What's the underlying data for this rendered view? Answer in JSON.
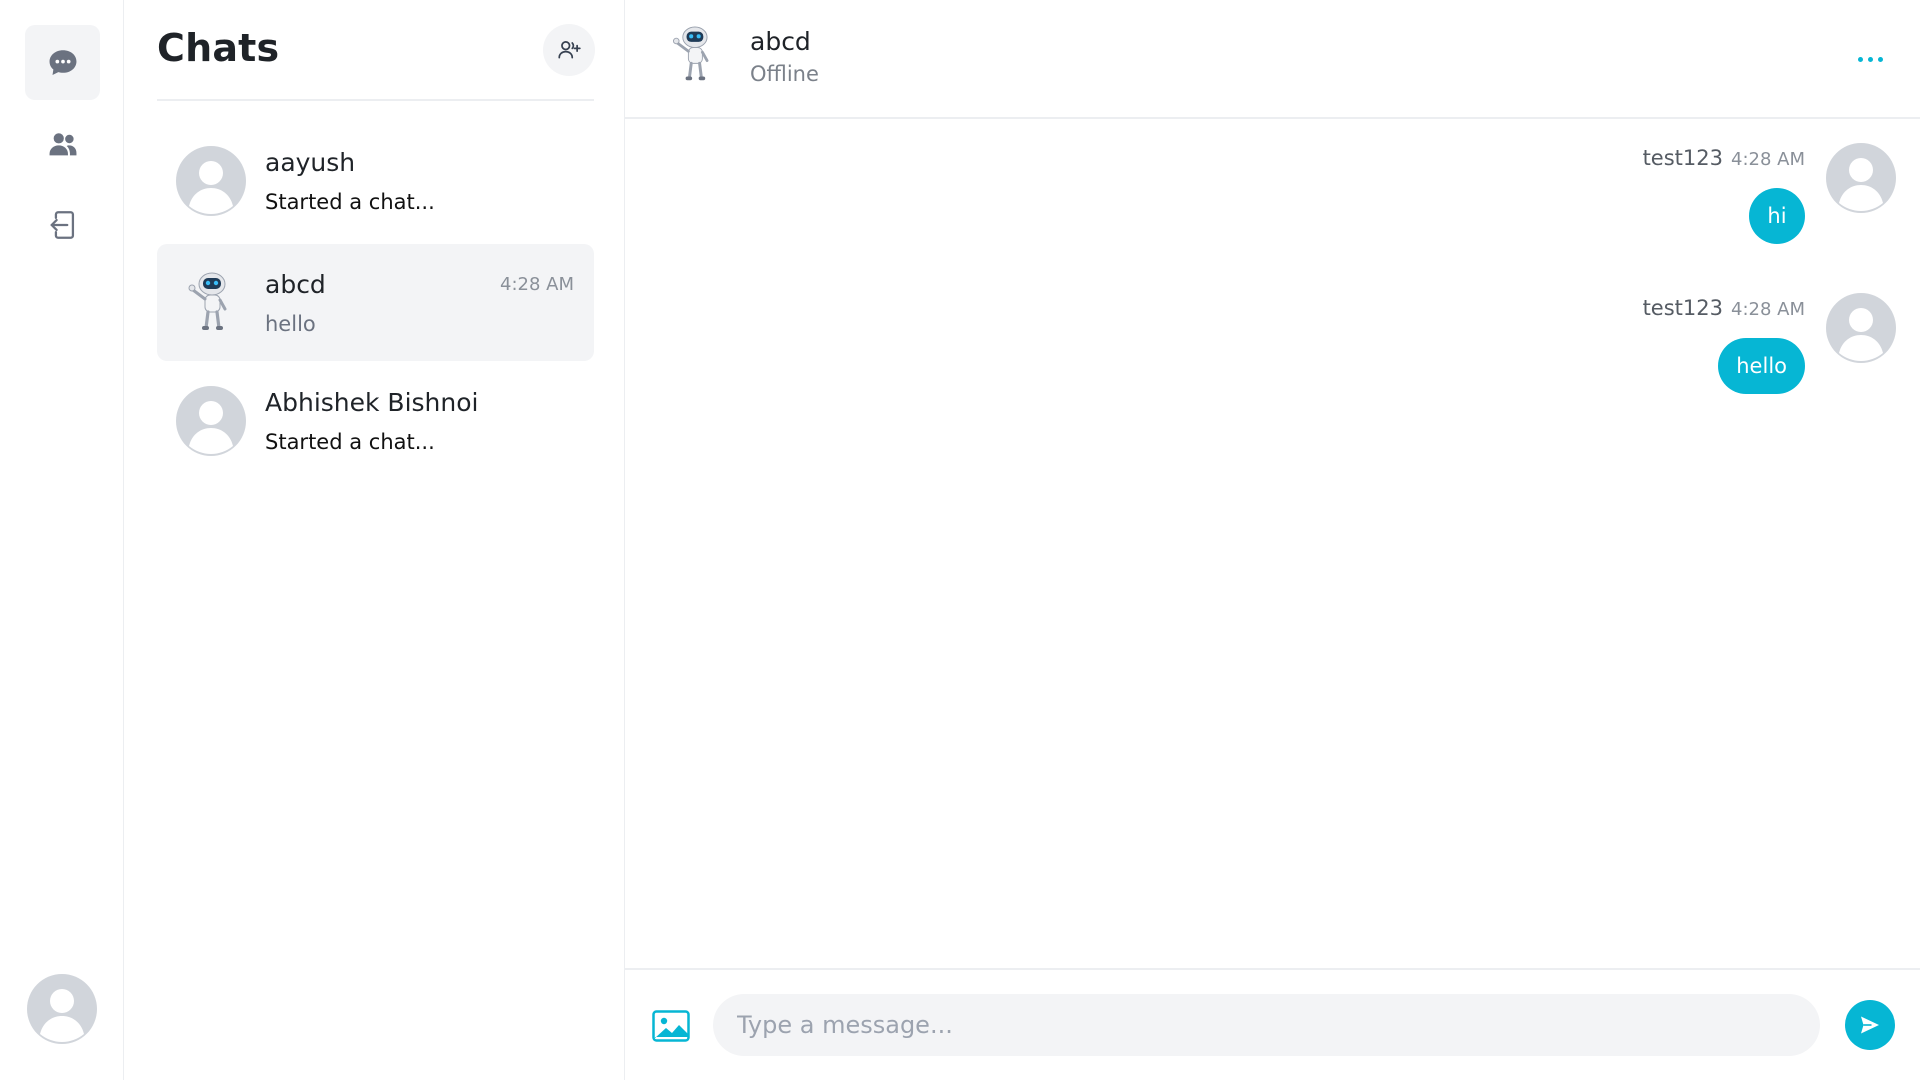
{
  "theme": {
    "accent": "#06b6d4",
    "icon_gray": "#6b7280",
    "avatar_gray": "#d1d5db"
  },
  "rail": {
    "items": [
      {
        "icon": "chat-bubble-icon",
        "active": true
      },
      {
        "icon": "users-icon",
        "active": false
      },
      {
        "icon": "logout-icon",
        "active": false
      }
    ],
    "profile_icon": "user-avatar-icon"
  },
  "chat_list": {
    "title": "Chats",
    "add_icon": "add-user-icon",
    "conversations": [
      {
        "name": "aayush",
        "preview": "Started a chat...",
        "time": "",
        "avatar": "default-avatar",
        "selected": false
      },
      {
        "name": "abcd",
        "preview": "hello",
        "time": "4:28 AM",
        "avatar": "robot-avatar",
        "selected": true
      },
      {
        "name": "Abhishek Bishnoi",
        "preview": "Started a chat...",
        "time": "",
        "avatar": "default-avatar",
        "selected": false
      }
    ]
  },
  "chat": {
    "header": {
      "name": "abcd",
      "status": "Offline",
      "avatar": "robot-avatar",
      "menu_icon": "more-dots-icon"
    },
    "messages": [
      {
        "sender": "test123",
        "time": "4:28 AM",
        "text": "hi"
      },
      {
        "sender": "test123",
        "time": "4:28 AM",
        "text": "hello"
      }
    ],
    "composer": {
      "placeholder": "Type a message...",
      "image_icon": "image-icon",
      "send_icon": "send-icon"
    }
  }
}
